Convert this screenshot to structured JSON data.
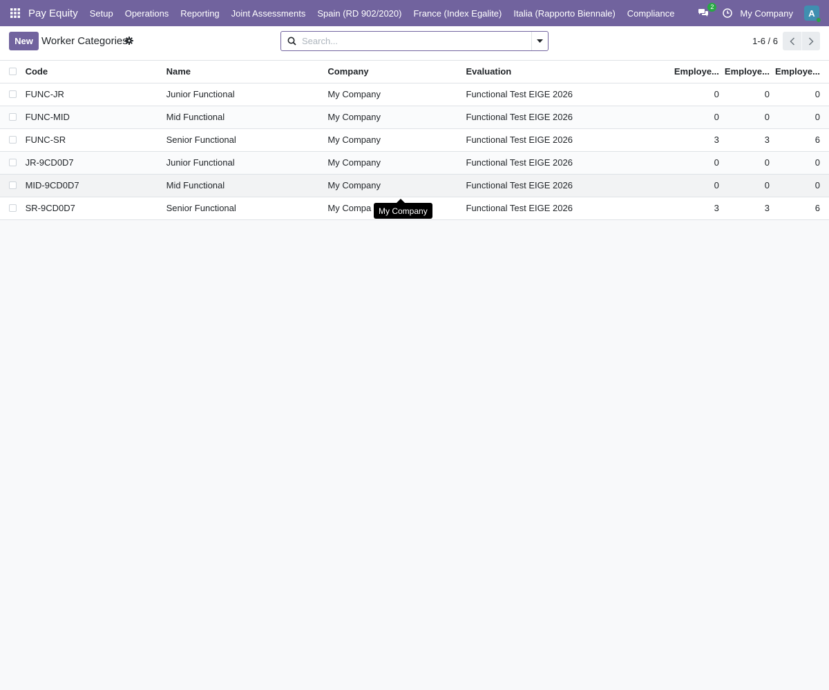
{
  "navbar": {
    "app_name": "Pay Equity",
    "menu": [
      "Setup",
      "Operations",
      "Reporting",
      "Joint Assessments",
      "Spain (RD 902/2020)",
      "France (Index Egalite)",
      "Italia (Rapporto Biennale)",
      "Compliance"
    ],
    "chat_badge": "2",
    "company": "My Company",
    "avatar_initial": "A",
    "brand_color": "#71639e"
  },
  "control": {
    "new_label": "New",
    "title": "Worker Categories",
    "search_placeholder": "Search...",
    "pager": "1-6 / 6"
  },
  "table": {
    "headers": [
      "Code",
      "Name",
      "Company",
      "Evaluation",
      "Employe...",
      "Employe...",
      "Employe..."
    ],
    "rows": [
      {
        "code": "FUNC-JR",
        "name": "Junior Functional",
        "company": "My Company",
        "evaluation": "Functional Test EIGE 2026",
        "e1": "0",
        "e2": "0",
        "e3": "0"
      },
      {
        "code": "FUNC-MID",
        "name": "Mid Functional",
        "company": "My Company",
        "evaluation": "Functional Test EIGE 2026",
        "e1": "0",
        "e2": "0",
        "e3": "0"
      },
      {
        "code": "FUNC-SR",
        "name": "Senior Functional",
        "company": "My Company",
        "evaluation": "Functional Test EIGE 2026",
        "e1": "3",
        "e2": "3",
        "e3": "6"
      },
      {
        "code": "JR-9CD0D7",
        "name": "Junior Functional",
        "company": "My Company",
        "evaluation": "Functional Test EIGE 2026",
        "e1": "0",
        "e2": "0",
        "e3": "0"
      },
      {
        "code": "MID-9CD0D7",
        "name": "Mid Functional",
        "company": "My Company",
        "evaluation": "Functional Test EIGE 2026",
        "e1": "0",
        "e2": "0",
        "e3": "0"
      },
      {
        "code": "SR-9CD0D7",
        "name": "Senior Functional",
        "company": "My Compa",
        "evaluation": "Functional Test EIGE 2026",
        "e1": "3",
        "e2": "3",
        "e3": "6"
      }
    ]
  },
  "tooltip": {
    "text": "My Company"
  }
}
